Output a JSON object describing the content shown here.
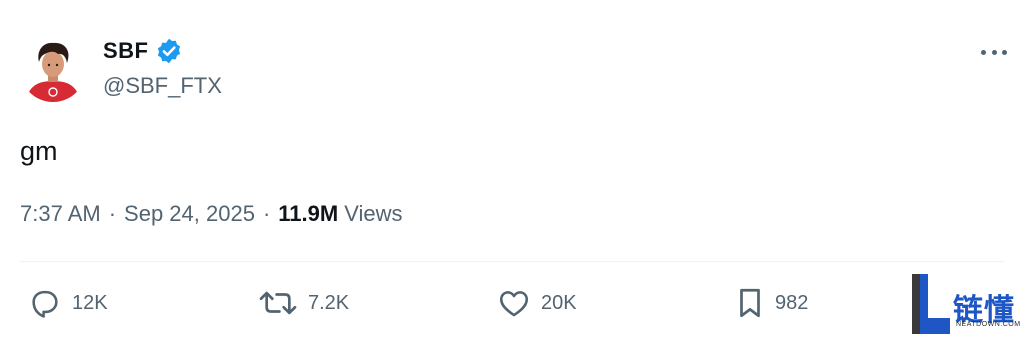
{
  "author": {
    "display_name": "SBF",
    "handle": "@SBF_FTX",
    "avatar_icon": "avatar-person-icon",
    "verified": true,
    "verified_color": "#1d9bf0"
  },
  "menu": {
    "more_icon": "more-horizontal-icon"
  },
  "tweet": {
    "text": "gm",
    "time": "7:37 AM",
    "separator1": "·",
    "date": "Sep 24, 2025",
    "separator2": "·",
    "views_count": "11.9M",
    "views_label": "Views"
  },
  "actions": {
    "reply": {
      "icon": "reply-icon",
      "count": "12K"
    },
    "repost": {
      "icon": "repost-icon",
      "count": "7.2K"
    },
    "like": {
      "icon": "heart-icon",
      "count": "20K"
    },
    "bookmark": {
      "icon": "bookmark-icon",
      "count": "982"
    }
  },
  "watermark": {
    "title": "链懂",
    "subtitle": "NEATDOWN.COM",
    "color": "#1f56c6"
  },
  "colors": {
    "text_primary": "#0f1419",
    "text_secondary": "#536471",
    "divider": "#eff3f4",
    "avatar_shirt": "#d62a35"
  }
}
